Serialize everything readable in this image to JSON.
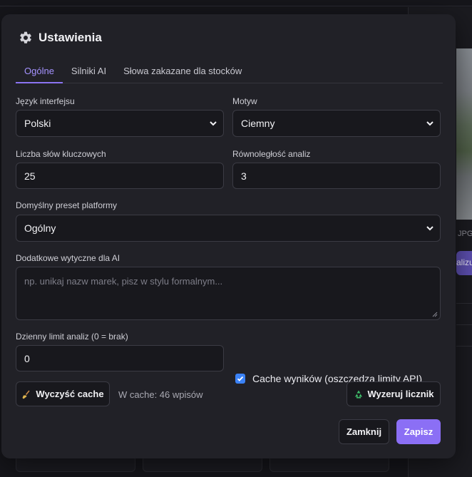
{
  "background": {
    "photo_label": "JPG",
    "action_label": "alizu"
  },
  "modal": {
    "title": "Ustawienia",
    "tabs": [
      {
        "label": "Ogólne",
        "active": true
      },
      {
        "label": "Silniki AI",
        "active": false
      },
      {
        "label": "Słowa zakazane dla stocków",
        "active": false
      }
    ],
    "fields": {
      "language": {
        "label": "Język interfejsu",
        "value": "Polski"
      },
      "theme": {
        "label": "Motyw",
        "value": "Ciemny"
      },
      "keywords": {
        "label": "Liczba słów kluczowych",
        "value": "25"
      },
      "parallel": {
        "label": "Równoległość analiz",
        "value": "3"
      },
      "preset": {
        "label": "Domyślny preset platformy",
        "value": "Ogólny"
      },
      "guidelines": {
        "label": "Dodatkowe wytyczne dla AI",
        "placeholder": "np. unikaj nazw marek, pisz w stylu formalnym..."
      },
      "daily_limit": {
        "label": "Dzienny limit analiz (0 = brak)",
        "value": "0"
      }
    },
    "cache_checkbox": {
      "label": "Cache wyników (oszczędza limity API)",
      "checked": true
    },
    "clear_cache_button": "Wyczyść cache",
    "cache_info": "W cache: 46 wpisów",
    "reset_counter_button": "Wyzeruj licznik",
    "close_button": "Zamknij",
    "save_button": "Zapisz"
  },
  "colors": {
    "accent": "#8b6ff5",
    "tab_active": "#a593ff",
    "checkbox": "#3b82f6",
    "modal_bg": "#212127"
  }
}
